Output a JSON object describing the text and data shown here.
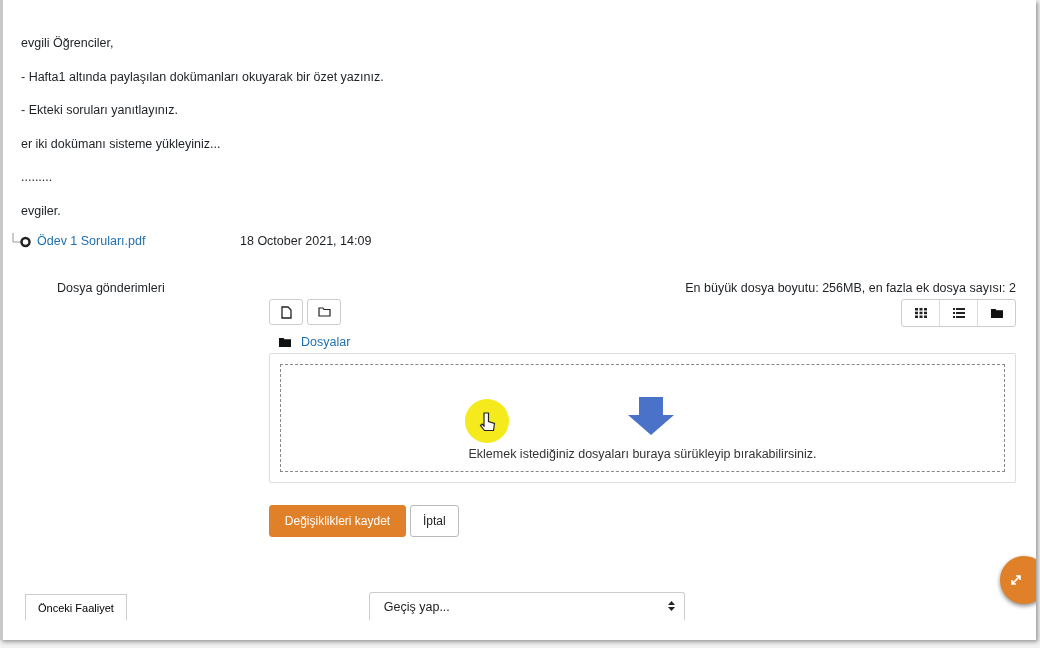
{
  "intro": [
    "evgili Öğrenciler,",
    "- Hafta1 altında paylaşılan dokümanları okuyarak bir özet yazınız.",
    "- Ekteki soruları yanıtlayınız.",
    "er iki dokümanı sisteme yükleyiniz...",
    ".........",
    "evgiler."
  ],
  "attachment": {
    "name": "Ödev 1 Soruları.pdf",
    "date": "18 October 2021, 14:09"
  },
  "submission": {
    "label": "Dosya gönderimleri",
    "limits": "En büyük dosya boyutu: 256MB, en fazla ek dosya sayısı: 2",
    "path": "Dosyalar",
    "drop_hint": "Eklemek istediğiniz dosyaları buraya sürükleyip bırakabilirsiniz."
  },
  "buttons": [
    {
      "label": "Değişiklikleri kaydet",
      "kind": "primary"
    },
    {
      "label": "İptal",
      "kind": "secondary"
    }
  ],
  "footer": {
    "previous": "Önceki Faaliyet",
    "jump": {
      "placeholder": "Geçiş yap..."
    }
  }
}
